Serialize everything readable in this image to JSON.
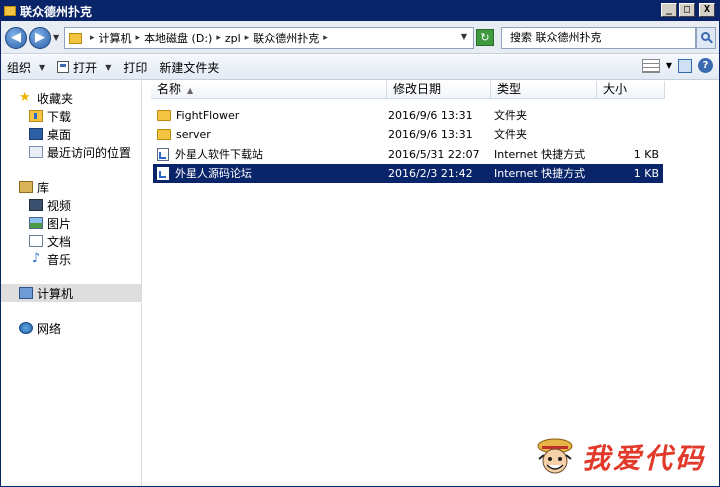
{
  "window": {
    "title": "联众德州扑克",
    "controls": {
      "minimize": "_",
      "maximize": "□",
      "close": "X"
    }
  },
  "address": {
    "crumbs": [
      "计算机",
      "本地磁盘 (D:)",
      "zpl",
      "联众德州扑克"
    ],
    "search_placeholder": "搜索 联众德州扑克"
  },
  "toolbar": {
    "organize": "组织",
    "open": "打开",
    "print": "打印",
    "new_folder": "新建文件夹"
  },
  "nav": {
    "favorites": "收藏夹",
    "downloads": "下载",
    "desktop": "桌面",
    "recent": "最近访问的位置",
    "libraries": "库",
    "videos": "视频",
    "pictures": "图片",
    "documents": "文档",
    "music": "音乐",
    "computer": "计算机",
    "network": "网络"
  },
  "columns": {
    "name": "名称",
    "date": "修改日期",
    "type": "类型",
    "size": "大小"
  },
  "files": [
    {
      "name": "FightFlower",
      "date": "2016/9/6 13:31",
      "type": "文件夹",
      "size": "",
      "icon": "folder-icon"
    },
    {
      "name": "server",
      "date": "2016/9/6 13:31",
      "type": "文件夹",
      "size": "",
      "icon": "folder-icon"
    },
    {
      "name": "外星人软件下载站",
      "date": "2016/5/31 22:07",
      "type": "Internet 快捷方式",
      "size": "1 KB",
      "icon": "internet-shortcut-icon"
    },
    {
      "name": "外星人源码论坛",
      "date": "2016/2/3 21:42",
      "type": "Internet 快捷方式",
      "size": "1 KB",
      "icon": "internet-shortcut-icon",
      "selected": true
    }
  ],
  "watermark": {
    "text": "我爱代码"
  },
  "colors": {
    "titlebar": "#0a246a",
    "selection": "#0a246a",
    "watermark": "#e23a2a"
  }
}
